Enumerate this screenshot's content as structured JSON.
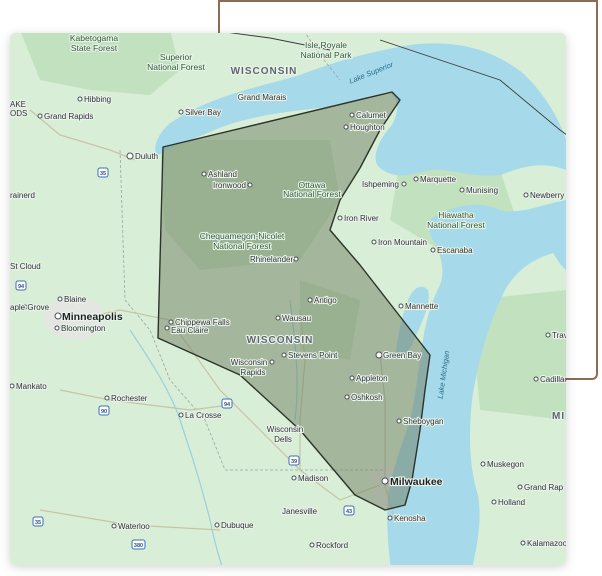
{
  "labels": {
    "kabetogama": "Kabetogama",
    "kabetogama_2": "State Forest",
    "superior_nf": "Superior",
    "superior_nf_2": "National Forest",
    "isle_royale": "Isle Royale",
    "isle_royale_2": "National Park",
    "lake_superior": "Lake Superior",
    "lake_michigan": "Lake Michigan",
    "grand_marais": "Grand Marais",
    "wisconsin_top": "WISCONSIN",
    "lake_edge": "AKE",
    "lake_edge_2": "ODS",
    "hibbing": "Hibbing",
    "grand_rapids_mn": "Grand Rapids",
    "silver_bay": "Silver Bay",
    "calumet": "Calumet",
    "houghton": "Houghton",
    "duluth": "Duluth",
    "ashland": "Ashland",
    "ironwood": "Ironwood",
    "ottawa_nf": "Ottawa",
    "ottawa_nf_2": "National Forest",
    "ishpeming": "Ishpeming",
    "marquette": "Marquette",
    "munising": "Munising",
    "newberry": "Newberry",
    "hiawatha": "Hiawatha",
    "hiawatha_2": "National Forest",
    "iron_river": "Iron River",
    "iron_mountain": "Iron Mountain",
    "escanaba": "Escanaba",
    "chequamegon": "Chequamegon-Nicolet",
    "chequamegon_2": "National Forest",
    "rhinelander": "Rhinelander",
    "brainerd": "rainerd",
    "st_cloud": "St Cloud",
    "antigo": "Antigo",
    "manistique": "Mannette",
    "blaine": "Blaine",
    "maple_grove": "aple Grove",
    "minneapolis": "Minneapolis",
    "bloomington": "Bloomington",
    "chippewa_falls": "Chippewa Falls",
    "eau_claire": "Eau Claire",
    "wausau": "Wausau",
    "wisconsin_state": "WISCONSIN",
    "stevens_point": "Stevens Point",
    "green_bay": "Green Bay",
    "traverse_city": "Traverse Ci",
    "wisconsin_rapids": "Wisconsin",
    "wisconsin_rapids_2": "Rapids",
    "appleton": "Appleton",
    "mankato": "Mankato",
    "cadillac": "Cadillac",
    "oshkosh": "Oshkosh",
    "rochester": "Rochester",
    "la_crosse": "La Crosse",
    "sheboygan": "Sheboygan",
    "mi_edge": "MI",
    "wisconsin_dells": "Wisconsin",
    "wisconsin_dells_2": "Dells",
    "muskegon": "Muskegon",
    "madison": "Madison",
    "milwaukee": "Milwaukee",
    "grand_rapids_mi": "Grand Rap",
    "janesville": "Janesville",
    "holland": "Holland",
    "kenosha": "Kenosha",
    "waterloo": "Waterloo",
    "dubuque": "Dubuque",
    "rockford": "Rockford",
    "kalamazoo": "Kalamazoo"
  },
  "shields": {
    "i35_north": "35",
    "i94_west": "94",
    "i90_west": "90",
    "i94_wi": "94",
    "i39": "39",
    "i90_south": "90",
    "i43": "43",
    "i380": "380",
    "i35_south": "35"
  },
  "colors": {
    "water": "#a6d9ea",
    "land": "#d8eed6",
    "forest": "#bfe0bd",
    "urban": "#e6e7e4",
    "region_fill": "#7a8a6a",
    "region_stroke": "#2d332a",
    "frame": "#8a6d55"
  }
}
